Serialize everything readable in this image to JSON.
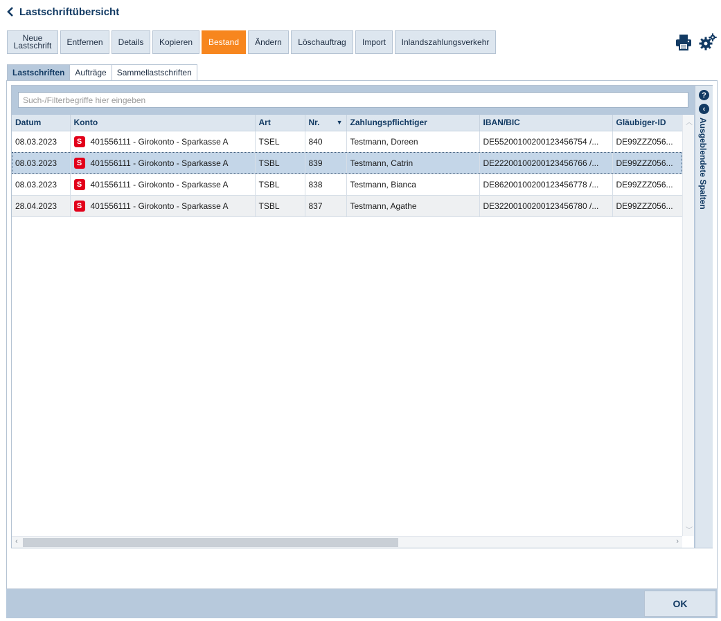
{
  "header": {
    "title": "Lastschriftübersicht",
    "back_icon": "chevron-left-icon"
  },
  "toolbar": {
    "buttons": [
      {
        "label": "Neue Lastschrift",
        "active": false
      },
      {
        "label": "Entfernen",
        "active": false
      },
      {
        "label": "Details",
        "active": false
      },
      {
        "label": "Kopieren",
        "active": false
      },
      {
        "label": "Bestand",
        "active": true
      },
      {
        "label": "Ändern",
        "active": false
      },
      {
        "label": "Löschauftrag",
        "active": false
      },
      {
        "label": "Import",
        "active": false
      },
      {
        "label": "Inlandszahlungsverkehr",
        "active": false
      }
    ],
    "new_line1": "Neue",
    "new_line2": "Lastschrift",
    "icons": [
      "printer-icon",
      "settings-gears-icon"
    ]
  },
  "tabs": [
    {
      "label": "Lastschriften",
      "active": true
    },
    {
      "label": "Aufträge",
      "active": false
    },
    {
      "label": "Sammellastschriften",
      "active": false
    }
  ],
  "filter": {
    "placeholder": "Such-/Filterbegriffe hier eingeben",
    "value": ""
  },
  "table": {
    "columns": [
      "Datum",
      "Konto",
      "Art",
      "Nr.",
      "Zahlungspflichtiger",
      "IBAN/BIC",
      "Gläubiger-ID"
    ],
    "sorted_column": "Nr.",
    "sort_direction": "descending",
    "rows": [
      {
        "datum": "08.03.2023",
        "konto": "401556111 - Girokonto - Sparkasse A",
        "art": "TSEL",
        "nr": "840",
        "zahlungspflichtiger": "Testmann, Doreen",
        "iban_bic": "DE55200100200123456754 /...",
        "glaeubiger_id": "DE99ZZZ056...",
        "selected": false
      },
      {
        "datum": "08.03.2023",
        "konto": "401556111 - Girokonto - Sparkasse A",
        "art": "TSBL",
        "nr": "839",
        "zahlungspflichtiger": "Testmann, Catrin",
        "iban_bic": "DE22200100200123456766 /...",
        "glaeubiger_id": "DE99ZZZ056...",
        "selected": true
      },
      {
        "datum": "08.03.2023",
        "konto": "401556111 - Girokonto - Sparkasse A",
        "art": "TSBL",
        "nr": "838",
        "zahlungspflichtiger": "Testmann, Bianca",
        "iban_bic": "DE86200100200123456778 /...",
        "glaeubiger_id": "DE99ZZZ056...",
        "selected": false
      },
      {
        "datum": "28.04.2023",
        "konto": "401556111 - Girokonto - Sparkasse A",
        "art": "TSBL",
        "nr": "837",
        "zahlungspflichtiger": "Testmann, Agathe",
        "iban_bic": "DE32200100200123456780 /...",
        "glaeubiger_id": "DE99ZZZ056...",
        "selected": false
      }
    ],
    "account_icon": "sparkasse-logo-icon",
    "account_icon_glyph": "S"
  },
  "side_panel": {
    "label": "Ausgeblendete Spalten",
    "help_glyph": "?",
    "collapse_glyph": "‹",
    "icons": [
      "help-icon",
      "collapse-icon"
    ]
  },
  "footer": {
    "ok_label": "OK"
  },
  "colors": {
    "accent_active": "#f7861e",
    "header_text": "#123a63",
    "panel_bg": "#b7c9dc",
    "selected_row": "#c4d6e8",
    "sparkasse_red": "#e2001a"
  }
}
